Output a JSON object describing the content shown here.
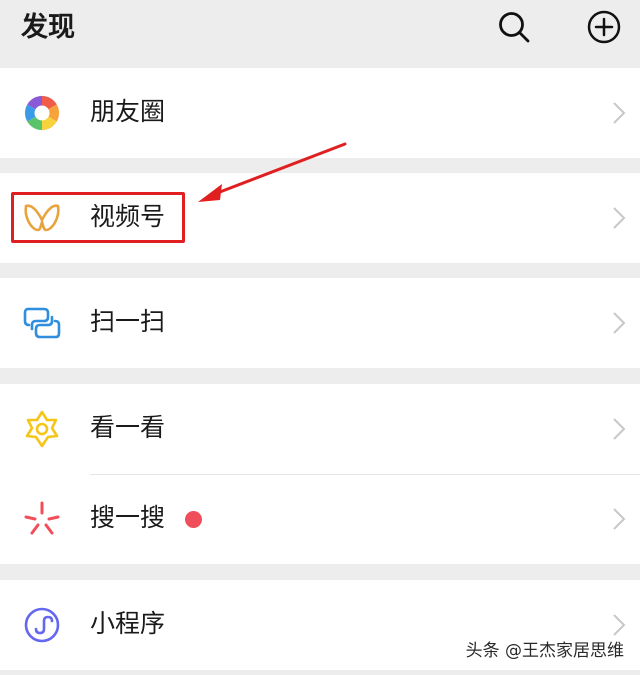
{
  "header": {
    "title": "发现",
    "search_icon": "search-icon",
    "add_icon": "plus-circle-icon"
  },
  "menu": {
    "moments": {
      "label": "朋友圈",
      "icon": "aperture-icon"
    },
    "channels": {
      "label": "视频号",
      "icon": "channels-butterfly-icon"
    },
    "scan": {
      "label": "扫一扫",
      "icon": "scan-icon"
    },
    "top_stories": {
      "label": "看一看",
      "icon": "star-flower-icon"
    },
    "search": {
      "label": "搜一搜",
      "icon": "search-asterisk-icon",
      "has_badge": true
    },
    "mini_programs": {
      "label": "小程序",
      "icon": "mini-program-icon"
    }
  },
  "annotation": {
    "highlight_color": "#e02020"
  },
  "watermark": {
    "text": "头条 @王杰家居思维"
  },
  "colors": {
    "background": "#ededed",
    "badge": "#f04e5a",
    "channels_icon": "#e8a33d",
    "scan_icon": "#2f8ede",
    "top_stories_icon": "#f5c518",
    "search_icon_color": "#f04e5a",
    "mini_program_icon": "#6467f0"
  }
}
